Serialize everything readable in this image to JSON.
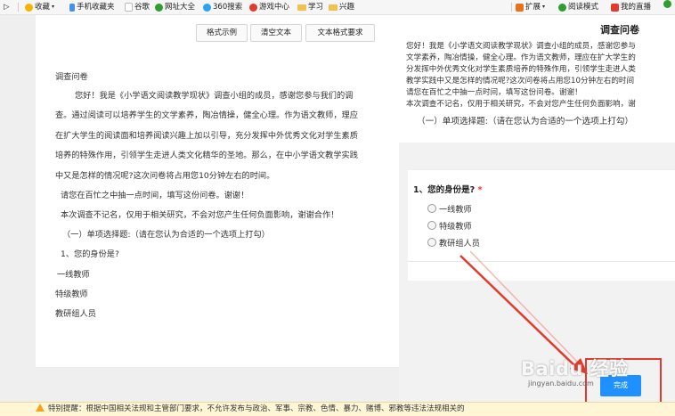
{
  "bookmarks": {
    "nav_glyph": "▷",
    "items": [
      {
        "label": "收藏",
        "icon": "star-icon",
        "color": "#f5b400"
      },
      {
        "label": "手机收藏夹",
        "icon": "phone-icon",
        "color": "#4a90e2"
      },
      {
        "label": "谷歌",
        "icon": "page-icon",
        "color": "#cccccc"
      },
      {
        "label": "网址大全",
        "icon": "globe-icon",
        "color": "#2e9e2e"
      },
      {
        "label": "360搜索",
        "icon": "search360-icon",
        "color": "#2aa3f0"
      },
      {
        "label": "游戏中心",
        "icon": "game-icon",
        "color": "#e23b2e"
      },
      {
        "label": "学习",
        "icon": "folder-icon",
        "color": "#f2c14e"
      },
      {
        "label": "兴趣",
        "icon": "folder-icon",
        "color": "#f2c14e"
      }
    ],
    "right_items": [
      {
        "label": "扩展",
        "icon": "grid-icon",
        "color": "#e8711a"
      },
      {
        "label": "阅读模式",
        "icon": "read-icon",
        "color": "#2e9e2e"
      },
      {
        "label": "我的直播",
        "icon": "live-icon",
        "color": "#e23b2e"
      }
    ]
  },
  "editor": {
    "buttons": {
      "format_example": "格式示例",
      "clear_text": "清空文本",
      "text_format_req": "文本格式要求"
    },
    "title": "调查问卷",
    "intro_lines": [
      "您好！我是《小学语文阅读教学现状》调查小组的成员，感谢您参与我们的调",
      "查。通过阅读可以培养学生的文学素养，陶冶情操，健全心理。作为语文教师，理应",
      "在扩大学生的阅读面和培养阅读兴趣上加以引导，充分发挥中外优秀文化对学生素质",
      "培养的特殊作用，引领学生走进人类文化精华的圣地。那么，在中小学语文教学实践",
      "中又是怎样的情况呢?这次问卷将占用您10分钟左右的时间。"
    ],
    "please": "请您在百忙之中抽一点时间，填写这份问卷。谢谢！",
    "anon": "本次调查不记名，仅用于相关研究，不会对您产生任何负面影响，谢谢合作！",
    "section": "（一）单项选择题:（请在您认为合适的一个选项上打勾）",
    "q1": "1、您的身份是?",
    "options": [
      "一线教师",
      "特级教师",
      "教研组人员"
    ]
  },
  "preview": {
    "title": "调查问卷",
    "lines": [
      "您好！我是《小学语文阅读教学现状》调查小组的成员，感谢您参与",
      "文学素养，陶冶情操，健全心理。作为语文教师，理应在扩大学生的",
      "分发挥中外优秀文化对学生素质培养的特殊作用，引领学生走进人类",
      "教学实践中又是怎样的情况呢?这次问卷将占用您10分钟左右的时间",
      "请您在百忙之中抽一点时间，填写这份问卷。谢谢！",
      "本次调查不记名，仅用于相关研究，不会对您产生任何负面影响，谢"
    ],
    "section": "（一）单项选择题:（请在您认为合适的一个选项上打勾）",
    "q1_title": "1、您的身份是?",
    "required_mark": "*",
    "options": [
      "一线教师",
      "特级教师",
      "教研组人员"
    ]
  },
  "done_button": "完成",
  "watermark": {
    "big": "Baidu 经验",
    "small": "jingyan.baidu.com"
  },
  "notice": "特别提醒：根据中国相关法规和主管部门要求，不允许发布与政治、军事、宗教、色情、暴力、赌博、邪教等违法法规相关的"
}
